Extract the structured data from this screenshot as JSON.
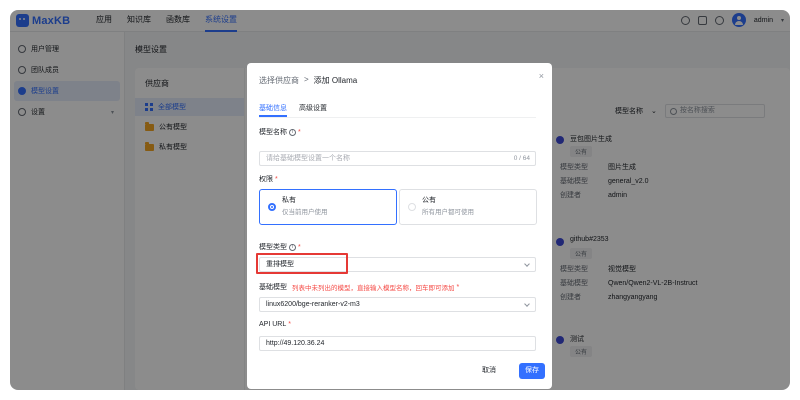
{
  "app": {
    "logo_text": "MaxKB",
    "brand_color": "#3370ff"
  },
  "nav": {
    "items": [
      "应用",
      "知识库",
      "函数库",
      "系统设置"
    ],
    "active": "系统设置"
  },
  "user": {
    "name": "admin"
  },
  "sidebar": {
    "items": [
      "用户管理",
      "团队成员",
      "模型设置",
      "设置"
    ],
    "active": "模型设置"
  },
  "page": {
    "title": "模型设置"
  },
  "providers": {
    "title": "供应商",
    "items": [
      "全部模型",
      "公有模型",
      "私有模型"
    ],
    "active": "全部模型"
  },
  "filter": {
    "field": "模型名称",
    "search_placeholder": "按名称搜索"
  },
  "models": [
    {
      "name": "豆包图片生成",
      "tag": "公有",
      "type_label": "模型类型",
      "type": "图片生成",
      "base_label": "基础模型",
      "base": "general_v2.0",
      "creator_label": "创建者",
      "creator": "admin"
    },
    {
      "name": "github#2353",
      "tag": "公有",
      "type_label": "模型类型",
      "type": "视觉模型",
      "base_label": "基础模型",
      "base": "Qwen/Qwen2-VL-2B-Instruct",
      "creator_label": "创建者",
      "creator": "zhangyangyang"
    },
    {
      "name": "测试",
      "tag": "公有"
    }
  ],
  "dialog": {
    "breadcrumb_parent": "选择供应商",
    "breadcrumb_sep": ">",
    "title": "添加 Ollama",
    "tabs": [
      "基础信息",
      "高级设置"
    ],
    "active_tab": "基础信息",
    "name_label": "模型名称",
    "name_placeholder": "请给基础模型设置一个名称",
    "name_counter": "0 / 64",
    "perm_label": "权限",
    "perm_options": [
      {
        "title": "私有",
        "desc": "仅当前用户使用",
        "selected": true
      },
      {
        "title": "公有",
        "desc": "所有用户都可使用",
        "selected": false
      }
    ],
    "type_label": "模型类型",
    "type_value": "重排模型",
    "base_label": "基础模型",
    "base_hint": "列表中未列出的模型，直接输入模型名称，回车即可添加",
    "base_value": "linux6200/bge-reranker-v2-m3",
    "api_label": "API URL",
    "api_value": "http://49.120.36.24",
    "cancel": "取消",
    "save": "保存",
    "close": "×"
  },
  "required_mark": "*",
  "info_mark": "i"
}
